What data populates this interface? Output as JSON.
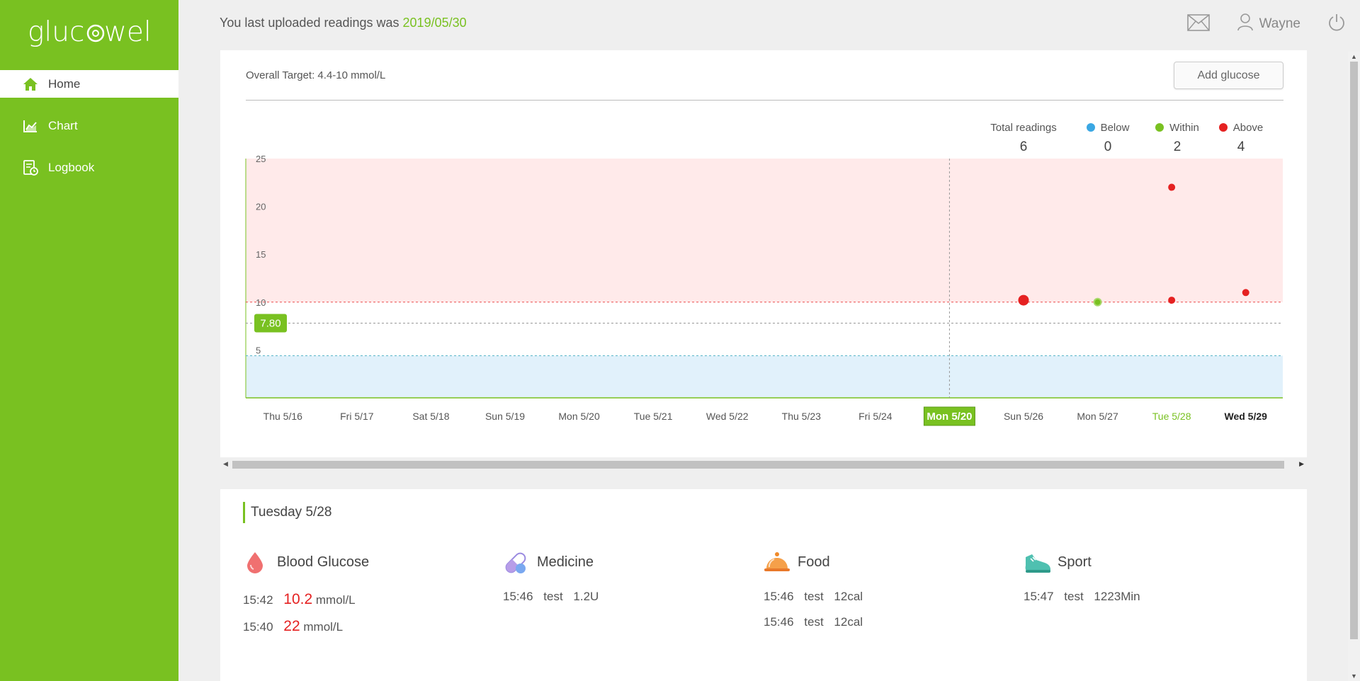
{
  "app": {
    "logo_text": "glucowell"
  },
  "sidebar": {
    "items": [
      {
        "label": "Home",
        "icon": "home-icon",
        "active": true
      },
      {
        "label": "Chart",
        "icon": "chart-icon",
        "active": false
      },
      {
        "label": "Logbook",
        "icon": "logbook-icon",
        "active": false
      }
    ]
  },
  "header": {
    "upload_prefix": "You last uploaded readings was ",
    "upload_date": "2019/05/30",
    "user_name": "Wayne"
  },
  "target": {
    "label": "Overall Target: 4.4-10 mmol/L",
    "add_button": "Add glucose"
  },
  "summary": {
    "total_label": "Total readings",
    "total_value": "6",
    "below_label": "Below",
    "below_value": "0",
    "within_label": "Within",
    "within_value": "2",
    "above_label": "Above",
    "above_value": "4"
  },
  "colors": {
    "brand": "#79c121",
    "below": "#3aa7e3",
    "within": "#79c121",
    "above": "#e52121",
    "above_zone": "#ffeaea",
    "below_zone": "#e1f1fb"
  },
  "chart_data": {
    "type": "scatter",
    "y_ticks": [
      "5",
      "10",
      "15",
      "20",
      "25"
    ],
    "ylim": [
      0,
      25
    ],
    "target_low": 4.4,
    "target_high": 10,
    "average_marker": 7.8,
    "average_label": "7.80",
    "categories": [
      "Thu 5/16",
      "Fri 5/17",
      "Sat 5/18",
      "Sun 5/19",
      "Mon 5/20",
      "Tue 5/21",
      "Wed 5/22",
      "Thu 5/23",
      "Fri 5/24",
      "Mon 5/20",
      "Sun 5/26",
      "Mon 5/27",
      "Tue 5/28",
      "Wed 5/29"
    ],
    "highlight_index": 9,
    "selected_index": 12,
    "bold_index": 13,
    "points": [
      {
        "day": "Sun 5/26",
        "value": 10.2,
        "status": "above",
        "large": true
      },
      {
        "day": "Mon 5/27",
        "value": 10,
        "status": "within",
        "large": false
      },
      {
        "day": "Tue 5/28",
        "value": 22,
        "status": "above",
        "large": false
      },
      {
        "day": "Tue 5/28",
        "value": 10.2,
        "status": "above",
        "large": false
      },
      {
        "day": "Wed 5/29",
        "value": 11,
        "status": "above",
        "large": false
      }
    ]
  },
  "detail": {
    "day_title": "Tuesday 5/28",
    "blood_glucose": {
      "label": "Blood Glucose",
      "entries": [
        {
          "time": "15:42",
          "value": "10.2",
          "unit": "mmol/L"
        },
        {
          "time": "15:40",
          "value": "22",
          "unit": "mmol/L"
        }
      ]
    },
    "medicine": {
      "label": "Medicine",
      "entries": [
        {
          "time": "15:46",
          "name": "test",
          "amount": "1.2U"
        }
      ]
    },
    "food": {
      "label": "Food",
      "entries": [
        {
          "time": "15:46",
          "name": "test",
          "amount": "12cal"
        },
        {
          "time": "15:46",
          "name": "test",
          "amount": "12cal"
        }
      ]
    },
    "sport": {
      "label": "Sport",
      "entries": [
        {
          "time": "15:47",
          "name": "test",
          "amount": "1223Min"
        }
      ]
    }
  }
}
